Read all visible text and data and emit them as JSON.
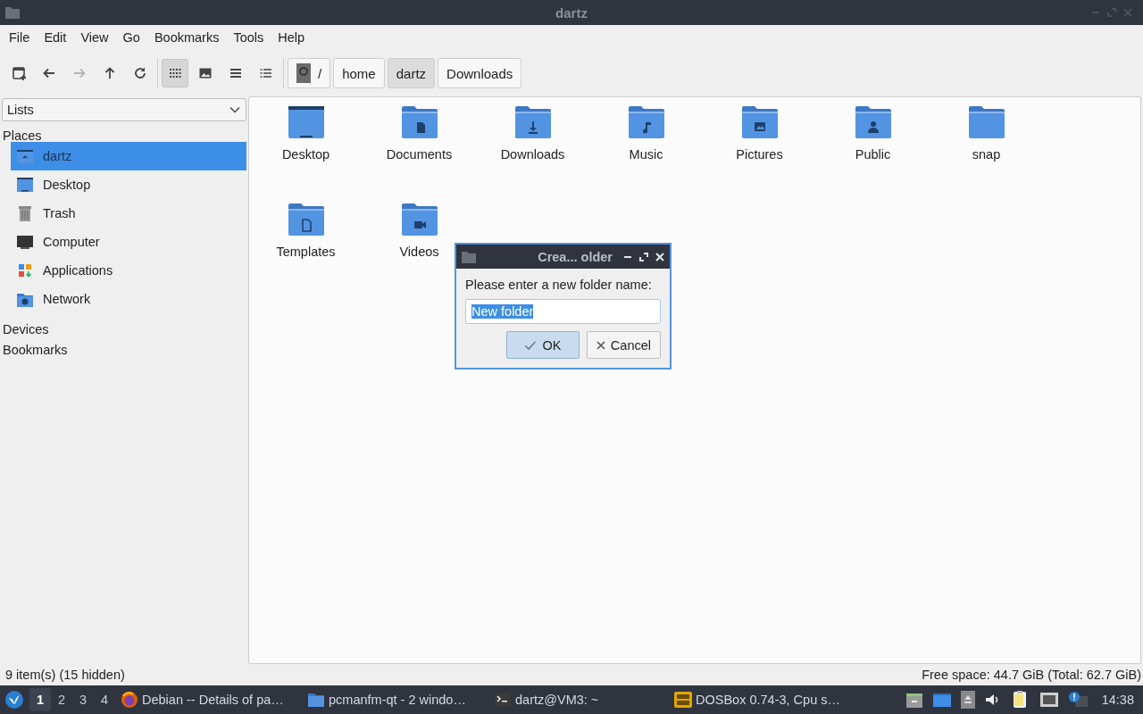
{
  "window": {
    "title": "dartz"
  },
  "menu": [
    "File",
    "Edit",
    "View",
    "Go",
    "Bookmarks",
    "Tools",
    "Help"
  ],
  "toolbar": [
    {
      "kind": "new-tab",
      "disabled": false
    },
    {
      "kind": "back",
      "disabled": false
    },
    {
      "kind": "forward",
      "disabled": true
    },
    {
      "kind": "up",
      "disabled": false
    },
    {
      "kind": "reload",
      "disabled": false
    },
    {
      "kind": "icon-view",
      "selected": true
    },
    {
      "kind": "thumbnail-view",
      "selected": false
    },
    {
      "kind": "compact-view",
      "selected": false
    },
    {
      "kind": "detail-view",
      "selected": false
    }
  ],
  "path": [
    {
      "label": "/",
      "kind": "root",
      "selected": false
    },
    {
      "label": "home",
      "kind": "dir",
      "selected": false
    },
    {
      "label": "dartz",
      "kind": "dir",
      "selected": true
    },
    {
      "label": "Downloads",
      "kind": "dir",
      "selected": false
    }
  ],
  "sidebar": {
    "mode": "Lists",
    "sections": [
      {
        "title": "Places",
        "items": [
          {
            "label": "dartz",
            "kind": "home",
            "selected": true
          },
          {
            "label": "Desktop",
            "kind": "desktop",
            "selected": false
          },
          {
            "label": "Trash",
            "kind": "trash",
            "selected": false
          },
          {
            "label": "Computer",
            "kind": "computer",
            "selected": false
          },
          {
            "label": "Applications",
            "kind": "applications",
            "selected": false
          },
          {
            "label": "Network",
            "kind": "network",
            "selected": false
          }
        ]
      },
      {
        "title": "Devices"
      },
      {
        "title": "Bookmarks"
      }
    ]
  },
  "files": [
    {
      "name": "Desktop",
      "kind": "desktop"
    },
    {
      "name": "Documents",
      "kind": "documents"
    },
    {
      "name": "Downloads",
      "kind": "downloads"
    },
    {
      "name": "Music",
      "kind": "music"
    },
    {
      "name": "Pictures",
      "kind": "pictures"
    },
    {
      "name": "Public",
      "kind": "public"
    },
    {
      "name": "snap",
      "kind": "plain"
    },
    {
      "name": "Templates",
      "kind": "templates"
    },
    {
      "name": "Videos",
      "kind": "videos"
    }
  ],
  "dialog": {
    "title": "Crea... older",
    "prompt": "Please enter a new folder name:",
    "value": "New folder",
    "buttons": [
      {
        "label": "OK",
        "kind": "ok",
        "default": true
      },
      {
        "label": "Cancel",
        "kind": "cancel",
        "default": false
      }
    ]
  },
  "status_bar": {
    "items": "9 item(s) (15 hidden)",
    "free_space": "Free space: 44.7 GiB (Total: 62.7 GiB)"
  },
  "taskbar": {
    "workspaces": [
      {
        "label": "1",
        "selected": true
      },
      {
        "label": "2",
        "selected": false
      },
      {
        "label": "3",
        "selected": false
      },
      {
        "label": "4",
        "selected": false
      }
    ],
    "tasks": [
      {
        "label": "Debian -- Details of pa…",
        "kind": "browser"
      },
      {
        "label": "pcmanfm-qt - 2 windo…",
        "kind": "folder"
      },
      {
        "label": "dartz@VM3: ~",
        "kind": "terminal"
      },
      {
        "label": "DOSBox 0.74-3, Cpu s…",
        "kind": "dosbox"
      }
    ],
    "clock": "14:38"
  }
}
